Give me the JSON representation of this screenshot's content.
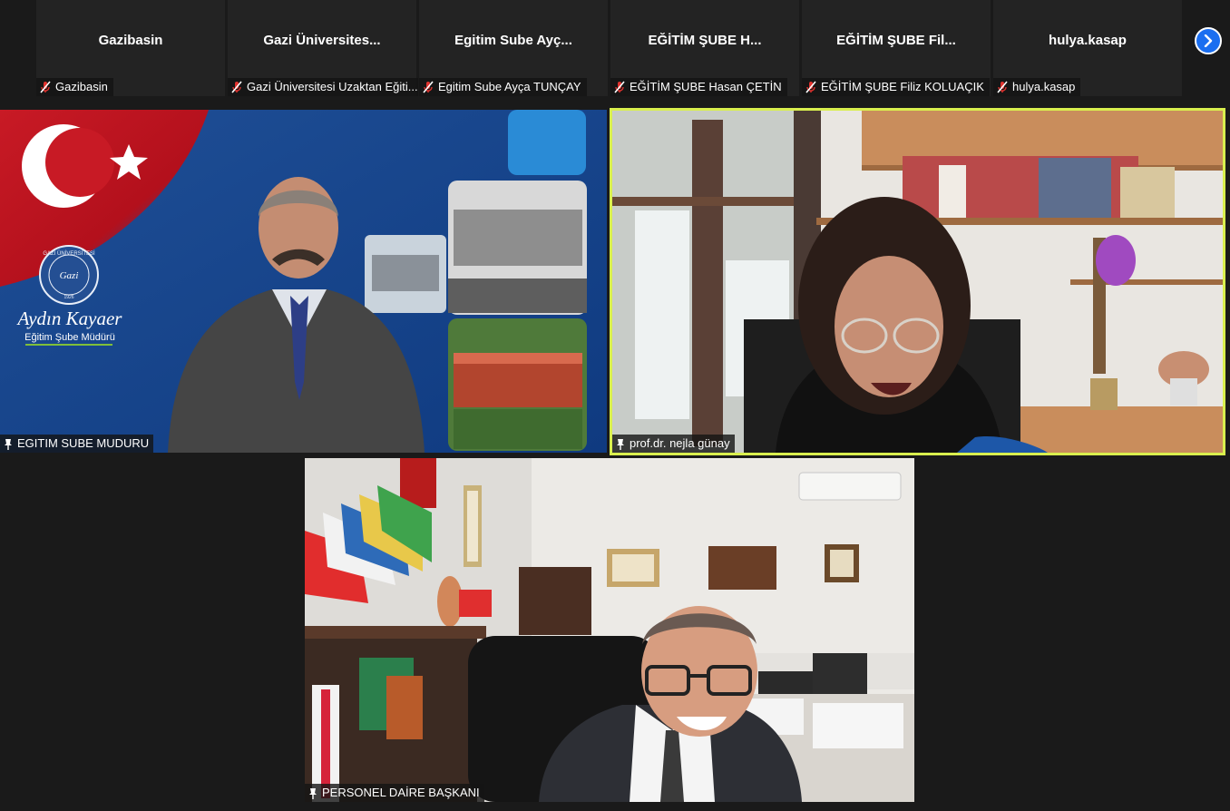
{
  "participants_strip": [
    {
      "display_name": "Gazibasin",
      "label": "Gazibasin"
    },
    {
      "display_name": "Gazi Üniversites...",
      "label": "Gazi Üniversitesi Uzaktan Eğiti..."
    },
    {
      "display_name": "Egitim Sube Ayç...",
      "label": "Egitim Sube Ayça TUNÇAY"
    },
    {
      "display_name": "EĞİTİM ŞUBE H...",
      "label": "EĞİTİM ŞUBE Hasan ÇETİN"
    },
    {
      "display_name": "EĞİTİM ŞUBE Fil...",
      "label": "EĞİTİM ŞUBE Filiz KOLUAÇIK"
    },
    {
      "display_name": "hulya.kasap",
      "label": "hulya.kasap"
    }
  ],
  "strip_controls": {
    "next_icon": "chevron-right-icon",
    "mic_icon": "mic-muted-icon"
  },
  "videos": [
    {
      "label": "EGITIM SUBE MUDURU",
      "background_text": {
        "logo_ring": "GAZİ ÜNİVERSİTESİ",
        "logo_center": "Gazi",
        "logo_year": "1926",
        "name": "Aydın Kayaer",
        "title": "Eğitim Şube Müdürü"
      }
    },
    {
      "label": "prof.dr. nejla günay",
      "active_speaker": true
    },
    {
      "label": "PERSONEL DAİRE BAŞKANI"
    }
  ],
  "colors": {
    "speaker_border": "#d9ef4e",
    "next_button": "#1a6ef0",
    "mic_muted": "#e0322e",
    "tile_bg": "#232323"
  }
}
